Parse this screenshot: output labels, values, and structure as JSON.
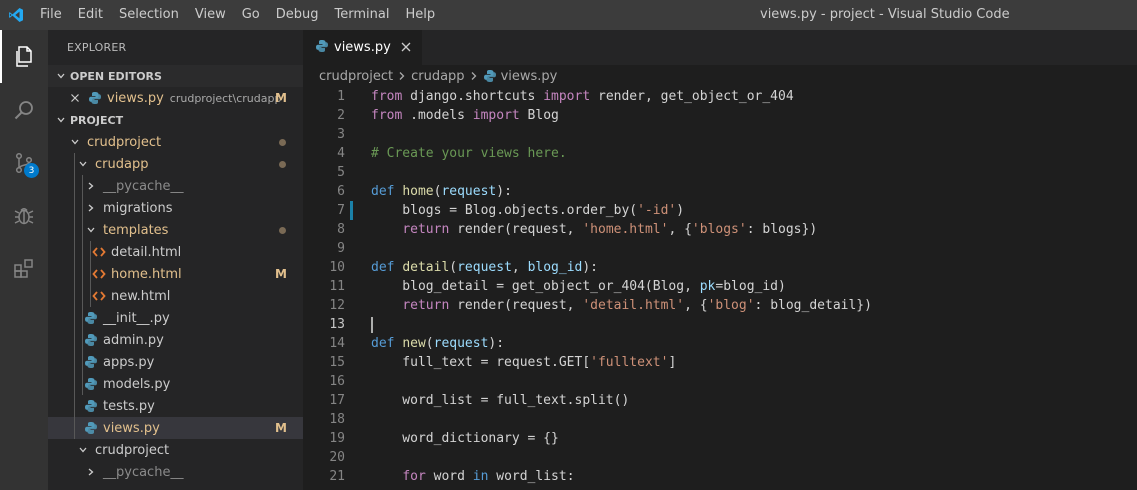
{
  "menu": [
    "File",
    "Edit",
    "Selection",
    "View",
    "Go",
    "Debug",
    "Terminal",
    "Help"
  ],
  "window_title": "views.py - project - Visual Studio Code",
  "activity": {
    "scm_badge": "3",
    "icons": [
      "files-icon",
      "search-icon",
      "source-control-icon",
      "debug-icon",
      "extensions-icon"
    ]
  },
  "sidebar": {
    "title": "EXPLORER",
    "open_editors_header": "OPEN EDITORS",
    "open_editor": {
      "name": "views.py",
      "desc": "crudproject\\crudapp",
      "mark": "M"
    },
    "project_header": "PROJECT",
    "tree": [
      {
        "name": "crudproject",
        "type": "folder-open",
        "depth": 0,
        "status": "dot",
        "modified": true
      },
      {
        "name": "crudapp",
        "type": "folder-open",
        "depth": 1,
        "status": "dot",
        "modified": true
      },
      {
        "name": "__pycache__",
        "type": "folder",
        "depth": 2,
        "status": "",
        "modified": false,
        "dim": true
      },
      {
        "name": "migrations",
        "type": "folder",
        "depth": 2,
        "status": "",
        "modified": false
      },
      {
        "name": "templates",
        "type": "folder-open",
        "depth": 2,
        "status": "dot",
        "modified": true
      },
      {
        "name": "detail.html",
        "type": "html",
        "depth": 3,
        "status": "",
        "modified": false
      },
      {
        "name": "home.html",
        "type": "html",
        "depth": 3,
        "status": "M",
        "modified": true
      },
      {
        "name": "new.html",
        "type": "html",
        "depth": 3,
        "status": "",
        "modified": false
      },
      {
        "name": "__init__.py",
        "type": "python",
        "depth": 2,
        "status": "",
        "modified": false
      },
      {
        "name": "admin.py",
        "type": "python",
        "depth": 2,
        "status": "",
        "modified": false
      },
      {
        "name": "apps.py",
        "type": "python",
        "depth": 2,
        "status": "",
        "modified": false
      },
      {
        "name": "models.py",
        "type": "python",
        "depth": 2,
        "status": "",
        "modified": false
      },
      {
        "name": "tests.py",
        "type": "python",
        "depth": 2,
        "status": "",
        "modified": false
      },
      {
        "name": "views.py",
        "type": "python",
        "depth": 2,
        "status": "M",
        "modified": true,
        "selected": true
      },
      {
        "name": "crudproject",
        "type": "folder-open",
        "depth": 1,
        "status": "",
        "modified": false
      },
      {
        "name": "__pycache__",
        "type": "folder",
        "depth": 2,
        "status": "",
        "modified": false,
        "dim": true
      }
    ]
  },
  "editor": {
    "tab_label": "views.py",
    "breadcrumbs": [
      "crudproject",
      "crudapp",
      "views.py"
    ],
    "current_line": 13,
    "lines": [
      [
        [
          "k",
          "from"
        ],
        [
          "t",
          " django.shortcuts "
        ],
        [
          "k",
          "import"
        ],
        [
          "t",
          " render, get_object_or_404"
        ]
      ],
      [
        [
          "k",
          "from"
        ],
        [
          "t",
          " .models "
        ],
        [
          "k",
          "import"
        ],
        [
          "t",
          " Blog"
        ]
      ],
      [],
      [
        [
          "c",
          "# Create your views here."
        ]
      ],
      [],
      [
        [
          "kb",
          "def"
        ],
        [
          "t",
          " "
        ],
        [
          "f",
          "home"
        ],
        [
          "t",
          "("
        ],
        [
          "p",
          "request"
        ],
        [
          "t",
          "):"
        ]
      ],
      [
        [
          "t",
          "    blogs = Blog.objects.order_by("
        ],
        [
          "s",
          "'-id'"
        ],
        [
          "t",
          ")"
        ]
      ],
      [
        [
          "t",
          "    "
        ],
        [
          "k",
          "return"
        ],
        [
          "t",
          " render(request, "
        ],
        [
          "s",
          "'home.html'"
        ],
        [
          "t",
          ", {"
        ],
        [
          "s",
          "'blogs'"
        ],
        [
          "t",
          ": blogs})"
        ]
      ],
      [],
      [
        [
          "kb",
          "def"
        ],
        [
          "t",
          " "
        ],
        [
          "f",
          "detail"
        ],
        [
          "t",
          "("
        ],
        [
          "p",
          "request"
        ],
        [
          "t",
          ", "
        ],
        [
          "p",
          "blog_id"
        ],
        [
          "t",
          "):"
        ]
      ],
      [
        [
          "t",
          "    blog_detail = get_object_or_404(Blog, "
        ],
        [
          "p",
          "pk"
        ],
        [
          "t",
          "=blog_id)"
        ]
      ],
      [
        [
          "t",
          "    "
        ],
        [
          "k",
          "return"
        ],
        [
          "t",
          " render(request, "
        ],
        [
          "s",
          "'detail.html'"
        ],
        [
          "t",
          ", {"
        ],
        [
          "s",
          "'blog'"
        ],
        [
          "t",
          ": blog_detail})"
        ]
      ],
      [],
      [
        [
          "kb",
          "def"
        ],
        [
          "t",
          " "
        ],
        [
          "f",
          "new"
        ],
        [
          "t",
          "("
        ],
        [
          "p",
          "request"
        ],
        [
          "t",
          "):"
        ]
      ],
      [
        [
          "t",
          "    full_text = request.GET["
        ],
        [
          "s",
          "'fulltext'"
        ],
        [
          "t",
          "]"
        ]
      ],
      [],
      [
        [
          "t",
          "    word_list = full_text.split()"
        ]
      ],
      [],
      [
        [
          "t",
          "    word_dictionary = {}"
        ]
      ],
      [],
      [
        [
          "t",
          "    "
        ],
        [
          "k",
          "for"
        ],
        [
          "t",
          " word "
        ],
        [
          "kb",
          "in"
        ],
        [
          "t",
          " word_list:"
        ]
      ]
    ]
  }
}
